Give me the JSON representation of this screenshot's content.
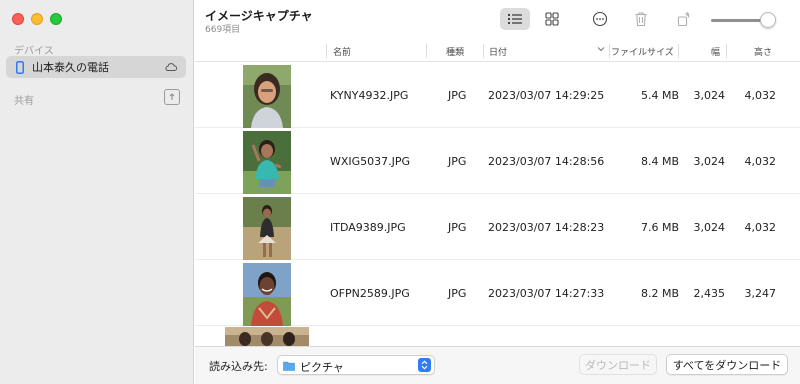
{
  "sidebar": {
    "devices_label": "デバイス",
    "device_name": "山本泰久の電話",
    "shared_label": "共有"
  },
  "toolbar": {
    "title": "イメージキャプチャ",
    "subtitle": "669項目",
    "view_list_icon": "list-view-icon",
    "view_grid_icon": "grid-view-icon",
    "slider_value": 0.85
  },
  "table": {
    "columns": {
      "name": "名前",
      "type": "種類",
      "date": "日付",
      "size": "ファイルサイズ",
      "width": "幅",
      "height": "高さ"
    },
    "rows": [
      {
        "name": "KYNY4932.JPG",
        "type": "JPG",
        "date": "2023/03/07 14:29:25",
        "size": "5.4 MB",
        "width": "3,024",
        "height": "4,032"
      },
      {
        "name": "WXIG5037.JPG",
        "type": "JPG",
        "date": "2023/03/07 14:28:56",
        "size": "8.4 MB",
        "width": "3,024",
        "height": "4,032"
      },
      {
        "name": "ITDA9389.JPG",
        "type": "JPG",
        "date": "2023/03/07 14:28:23",
        "size": "7.6 MB",
        "width": "3,024",
        "height": "4,032"
      },
      {
        "name": "OFPN2589.JPG",
        "type": "JPG",
        "date": "2023/03/07 14:27:33",
        "size": "8.2 MB",
        "width": "2,435",
        "height": "3,247"
      }
    ]
  },
  "footer": {
    "import_to_label": "読み込み先:",
    "destination": "ピクチャ",
    "import_button": "ダウンロード",
    "import_all_button": "すべてをダウンロード"
  },
  "colors": {
    "accent": "#2f7cf6",
    "sidebar_bg": "#ececec",
    "selected_row": "#d6d6d6"
  }
}
